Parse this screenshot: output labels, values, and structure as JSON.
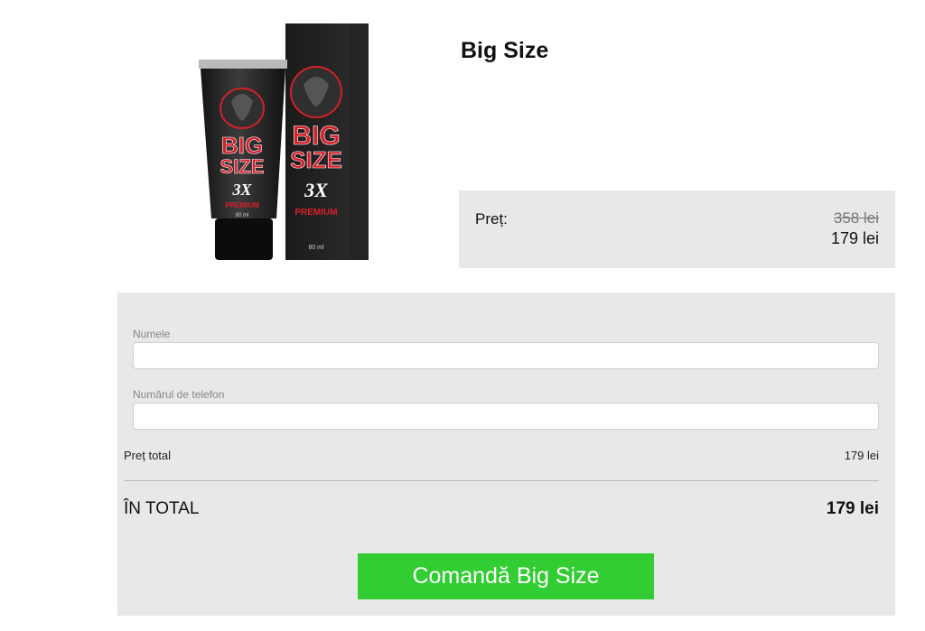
{
  "product": {
    "title": "Big Size",
    "image_alt": "Big Size 3X Premium tube and box",
    "image_texts": [
      "BIG",
      "SIZE",
      "3X",
      "PREMIUM",
      "80 ml"
    ]
  },
  "price": {
    "label": "Preț:",
    "old": "358 lei",
    "new": "179 lei"
  },
  "form": {
    "name_label": "Numele",
    "name_value": "",
    "phone_label": "Numărul de telefon",
    "phone_value": "",
    "subtotal_label": "Preț total",
    "subtotal_value": "179 lei",
    "total_label": "ÎN TOTAL",
    "total_value": "179 lei",
    "submit_label": "Comandă Big Size"
  },
  "colors": {
    "button_green": "#32cd32",
    "panel_gray": "#e8e8e8",
    "brand_red": "#d4202b"
  }
}
